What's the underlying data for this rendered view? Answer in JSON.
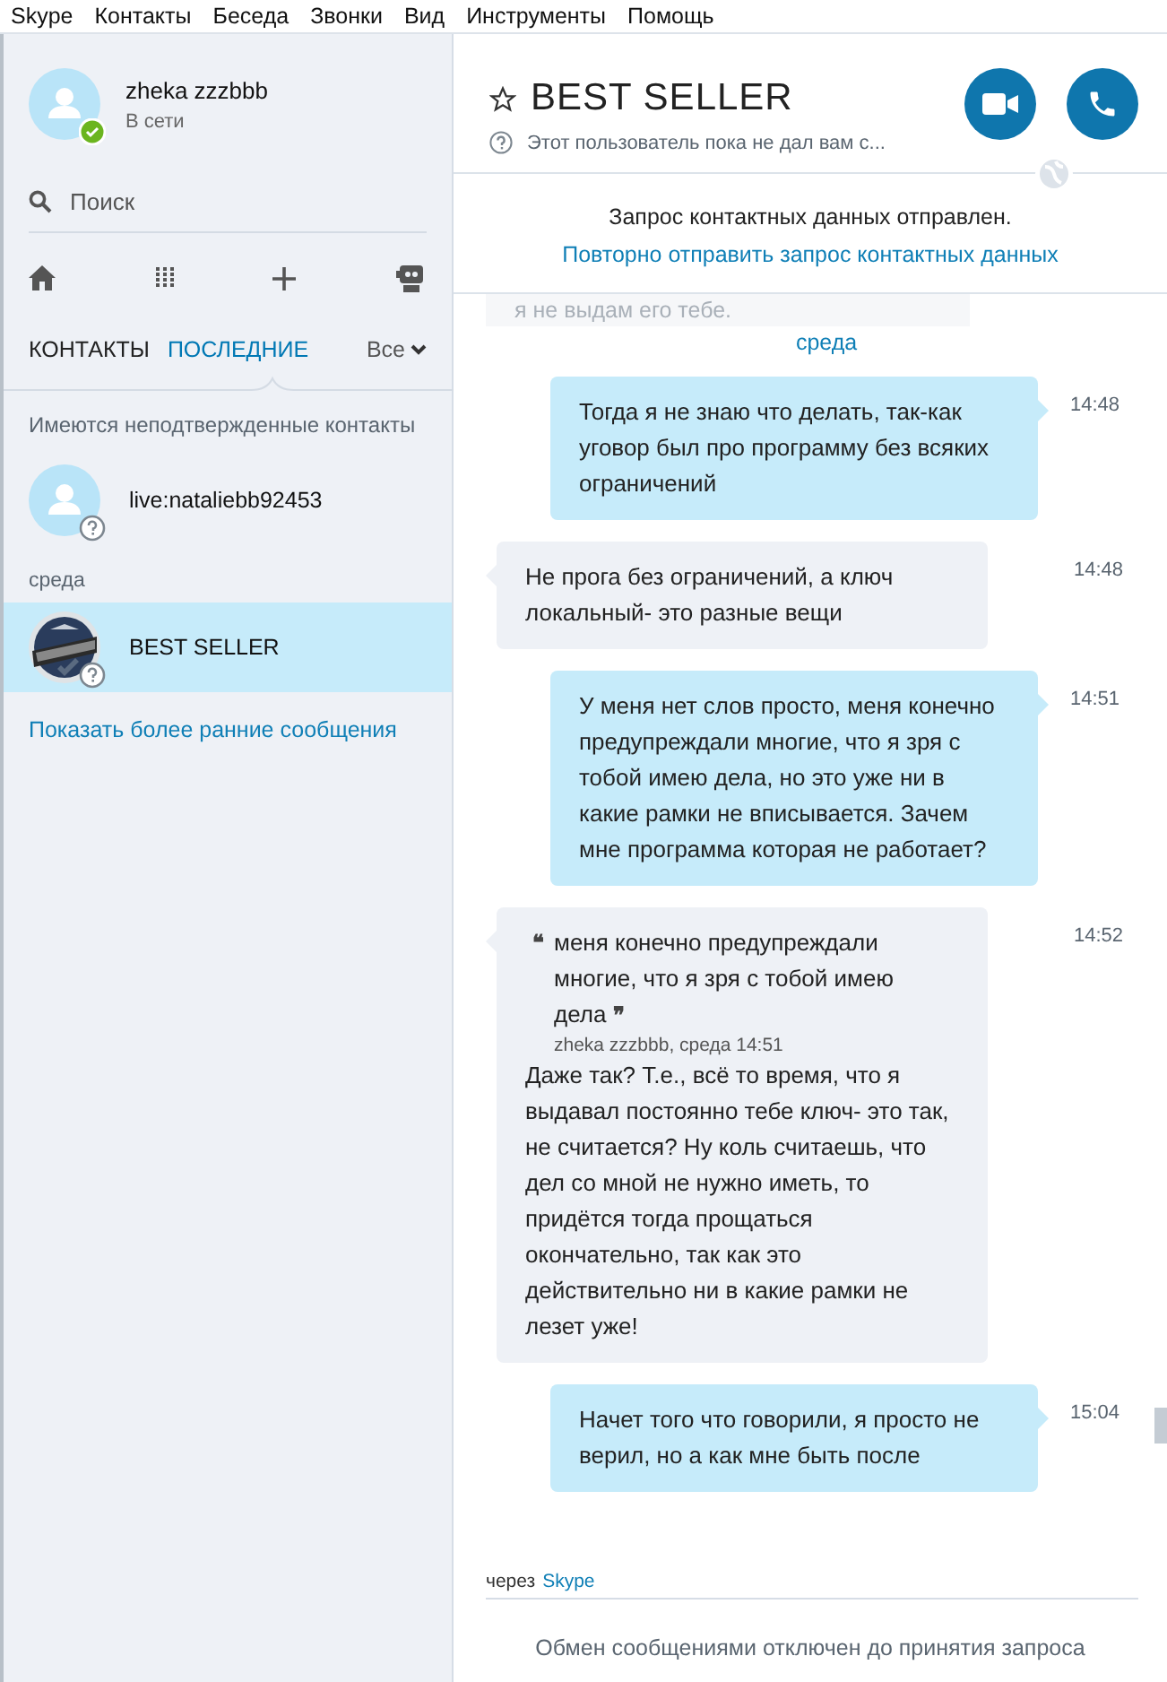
{
  "menu": [
    "Skype",
    "Контакты",
    "Беседа",
    "Звонки",
    "Вид",
    "Инструменты",
    "Помощь"
  ],
  "profile": {
    "name": "zheka zzzbbb",
    "status": "В сети",
    "online": true
  },
  "search": {
    "placeholder": "Поиск"
  },
  "tabs": [
    {
      "label": "КОНТАКТЫ",
      "selected": false
    },
    {
      "label": "ПОСЛЕДНИЕ",
      "selected": true
    }
  ],
  "filter": "Все",
  "notice": "Имеются неподтвержденные контакты",
  "groups": [
    {
      "contacts": [
        {
          "name": "live:nataliebb92453",
          "kind": "person",
          "selected": false
        }
      ]
    },
    {
      "label": "среда",
      "contacts": [
        {
          "name": "BEST SELLER",
          "kind": "picture",
          "selected": true
        }
      ]
    }
  ],
  "earlier_link": "Показать более ранние сообщения",
  "chat": {
    "title": "BEST SELLER",
    "subtitle": "Этот пользователь пока не дал вам с...",
    "favorite": false,
    "request": {
      "text": "Запрос контактных данных отправлен.",
      "link": "Повторно отправить запрос контактных данных"
    },
    "faded_fragment": "я не выдам его тебе.",
    "day": "среда",
    "messages": [
      {
        "kind": "outgoing",
        "time": "14:48",
        "text": "Тогда я не знаю что делать, так-как уговор был про программу без всяких ограничений"
      },
      {
        "kind": "incoming",
        "time": "14:48",
        "text": "Не прога без ограничений, а ключ локальный- это разные вещи"
      },
      {
        "kind": "outgoing",
        "time": "14:51",
        "text": "У меня нет слов просто, меня конечно предупреждали многие, что я зря с тобой имею дела, но это уже ни в какие рамки не вписывается. Зачем мне программа которая не работает?"
      },
      {
        "kind": "incoming",
        "time": "14:52",
        "quote": {
          "open": "❝",
          "text": "меня конечно предупреждали многие, что я зря с тобой имею дела",
          "close": "❞",
          "source": "zheka zzzbbb, среда 14:51"
        },
        "text": "Даже так? Т.е., всё то время, что я выдавал постоянно тебе ключ- это так, не считается? Ну коль считаешь, что дел со мной не нужно иметь, то придётся тогда прощаться окончательно, так как это действительно ни в какие рамки не лезет уже!"
      },
      {
        "kind": "outgoing",
        "time": "15:04",
        "text": "Начет того что говорили, я просто не верил, но а как мне быть после"
      }
    ],
    "via": {
      "prefix": "через",
      "link": "Skype"
    },
    "footer": "Обмен сообщениями отключен до принятия запроса"
  }
}
